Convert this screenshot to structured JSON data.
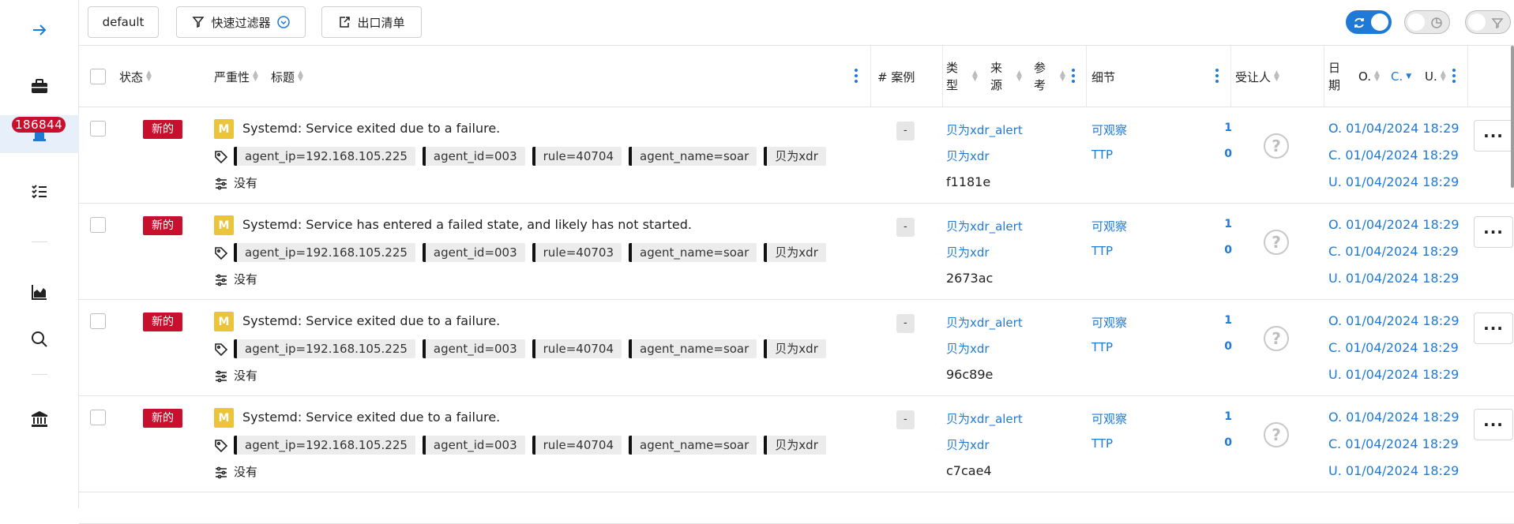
{
  "sidebar": {
    "badge_count": "186844",
    "items": [
      {
        "icon": "arrow-right-icon"
      },
      {
        "icon": "briefcase-icon"
      },
      {
        "icon": "alert-siren-icon"
      },
      {
        "icon": "tasks-list-icon"
      },
      {
        "icon": "chart-area-icon"
      },
      {
        "icon": "search-icon"
      },
      {
        "icon": "bank-icon"
      }
    ]
  },
  "toolbar": {
    "view_label": "default",
    "quick_filter_label": "快速过滤器",
    "export_label": "出口清单"
  },
  "columns": {
    "status": "状态",
    "severity": "严重性",
    "title": "标题",
    "cases": "# 案例",
    "type_1": "类",
    "type_2": "型",
    "source_1": "来",
    "source_2": "源",
    "ref_1": "参",
    "ref_2": "考",
    "details": "细节",
    "assignee": "受让人",
    "date_1": "日",
    "date_2": "期",
    "date_o": "O.",
    "date_c": "C.",
    "date_u": "U."
  },
  "rows": [
    {
      "status": "新的",
      "severity": "M",
      "title": "Systemd: Service exited due to a failure.",
      "tags": [
        "agent_ip=192.168.105.225",
        "agent_id=003",
        "rule=40704",
        "agent_name=soar",
        "贝为xdr"
      ],
      "none_label": "没有",
      "cases": "-",
      "type": "贝为xdr_alert",
      "source": "贝为xdr",
      "reference": "f1181e",
      "observables_label": "可观察",
      "observables_count": "1",
      "ttp_label": "TTP",
      "ttp_count": "0",
      "date_o": "O. 01/04/2024 18:29",
      "date_c": "C. 01/04/2024 18:29",
      "date_u": "U. 01/04/2024 18:29"
    },
    {
      "status": "新的",
      "severity": "M",
      "title": "Systemd: Service has entered a failed state, and likely has not started.",
      "tags": [
        "agent_ip=192.168.105.225",
        "agent_id=003",
        "rule=40703",
        "agent_name=soar",
        "贝为xdr"
      ],
      "none_label": "没有",
      "cases": "-",
      "type": "贝为xdr_alert",
      "source": "贝为xdr",
      "reference": "2673ac",
      "observables_label": "可观察",
      "observables_count": "1",
      "ttp_label": "TTP",
      "ttp_count": "0",
      "date_o": "O. 01/04/2024 18:29",
      "date_c": "C. 01/04/2024 18:29",
      "date_u": "U. 01/04/2024 18:29"
    },
    {
      "status": "新的",
      "severity": "M",
      "title": "Systemd: Service exited due to a failure.",
      "tags": [
        "agent_ip=192.168.105.225",
        "agent_id=003",
        "rule=40704",
        "agent_name=soar",
        "贝为xdr"
      ],
      "none_label": "没有",
      "cases": "-",
      "type": "贝为xdr_alert",
      "source": "贝为xdr",
      "reference": "96c89e",
      "observables_label": "可观察",
      "observables_count": "1",
      "ttp_label": "TTP",
      "ttp_count": "0",
      "date_o": "O. 01/04/2024 18:29",
      "date_c": "C. 01/04/2024 18:29",
      "date_u": "U. 01/04/2024 18:29"
    },
    {
      "status": "新的",
      "severity": "M",
      "title": "Systemd: Service exited due to a failure.",
      "tags": [
        "agent_ip=192.168.105.225",
        "agent_id=003",
        "rule=40704",
        "agent_name=soar",
        "贝为xdr"
      ],
      "none_label": "没有",
      "cases": "-",
      "type": "贝为xdr_alert",
      "source": "贝为xdr",
      "reference": "c7cae4",
      "observables_label": "可观察",
      "observables_count": "1",
      "ttp_label": "TTP",
      "ttp_count": "0",
      "date_o": "O. 01/04/2024 18:29",
      "date_c": "C. 01/04/2024 18:29",
      "date_u": "U. 01/04/2024 18:29"
    }
  ],
  "colors": {
    "accent": "#1f7ad6",
    "status_new": "#c8102e",
    "severity_medium": "#ebc43b"
  }
}
